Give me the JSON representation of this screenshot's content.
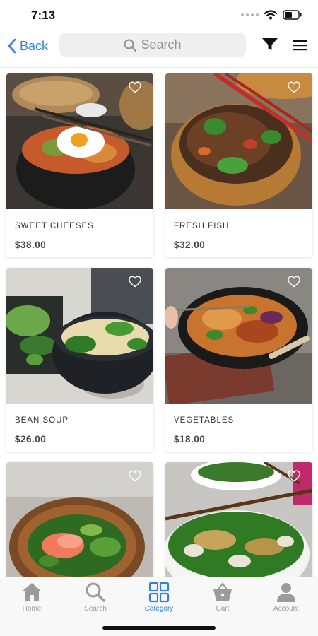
{
  "status": {
    "time": "7:13"
  },
  "nav": {
    "back_label": "Back",
    "search_placeholder": "Search"
  },
  "products": [
    {
      "name": "SWEET CHEESES",
      "price": "$38.00"
    },
    {
      "name": "FRESH FISH",
      "price": "$32.00"
    },
    {
      "name": "BEAN SOUP",
      "price": "$26.00"
    },
    {
      "name": "VEGETABLES",
      "price": "$18.00"
    },
    {
      "name": "",
      "price": ""
    },
    {
      "name": "",
      "price": ""
    }
  ],
  "tabs": [
    {
      "label": "Home",
      "icon": "home-icon",
      "active": false
    },
    {
      "label": "Search",
      "icon": "search-icon",
      "active": false
    },
    {
      "label": "Category",
      "icon": "category-grid-icon",
      "active": true
    },
    {
      "label": "Cart",
      "icon": "cart-icon",
      "active": false
    },
    {
      "label": "Account",
      "icon": "account-icon",
      "active": false
    }
  ],
  "colors": {
    "accent": "#2f80ed",
    "tab_inactive": "#9b9b9b"
  }
}
